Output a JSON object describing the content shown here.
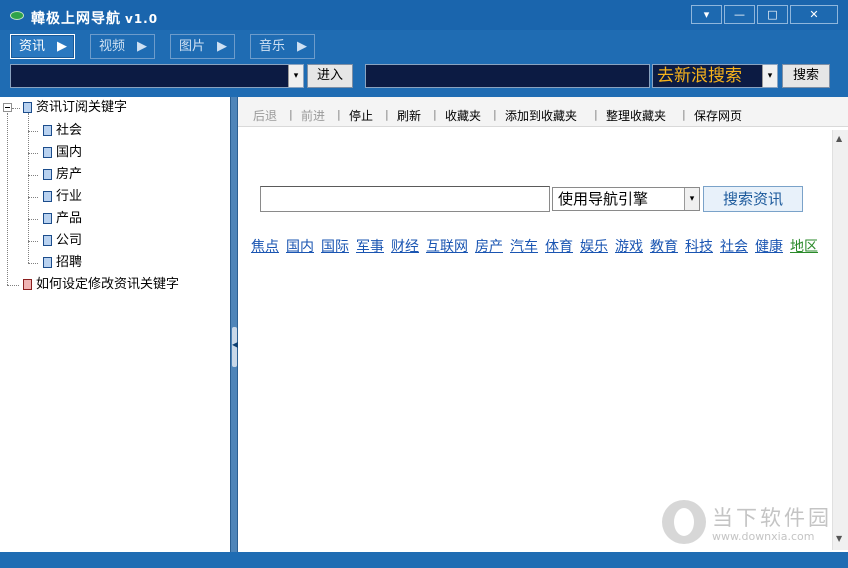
{
  "window": {
    "title": "韓极上网导航",
    "version": "v1.0",
    "controls": {
      "menu": "▾",
      "minimize": "—",
      "maximize": "□",
      "close": "✕"
    }
  },
  "nav": {
    "tabs": [
      {
        "label": "资讯",
        "active": true
      },
      {
        "label": "视频",
        "active": false
      },
      {
        "label": "图片",
        "active": false
      },
      {
        "label": "音乐",
        "active": false
      }
    ],
    "arrow": "▶"
  },
  "address": {
    "value": "",
    "dropdown": "▾",
    "enter_label": "进入"
  },
  "websearch": {
    "value": "",
    "engine_label": "去新浪搜索",
    "dropdown": "▾",
    "search_label": "搜索"
  },
  "tree": {
    "root_label": "资讯订阅关键字",
    "children": [
      "社会",
      "国内",
      "房产",
      "行业",
      "产品",
      "公司",
      "招聘"
    ],
    "help_label": "如何设定修改资讯关键字"
  },
  "toolbar": {
    "items": [
      {
        "label": "后退",
        "disabled": true
      },
      {
        "label": "前进",
        "disabled": true
      },
      {
        "label": "停止",
        "disabled": false
      },
      {
        "label": "刷新",
        "disabled": false
      },
      {
        "label": "收藏夹",
        "disabled": false
      },
      {
        "label": "添加到收藏夹",
        "disabled": false
      },
      {
        "label": "整理收藏夹",
        "disabled": false
      },
      {
        "label": "保存网页",
        "disabled": false
      }
    ],
    "separator": "|"
  },
  "search": {
    "value": "",
    "engine_selected": "使用导航引擎",
    "dropdown": "▾",
    "button_label": "搜索资讯"
  },
  "categories": [
    "焦点",
    "国内",
    "国际",
    "军事",
    "财经",
    "互联网",
    "房产",
    "汽车",
    "体育",
    "娱乐",
    "游戏",
    "教育",
    "科技",
    "社会",
    "健康",
    "地区"
  ],
  "scroll": {
    "up": "▲",
    "down": "▼"
  },
  "watermark": {
    "text": "当下软件园",
    "url": "www.downxia.com"
  },
  "colors": {
    "window_blue": "#1f6cb3",
    "link_blue": "#1a55b2",
    "link_green": "#2a8a2a",
    "engine_gold": "#f6b21c"
  }
}
